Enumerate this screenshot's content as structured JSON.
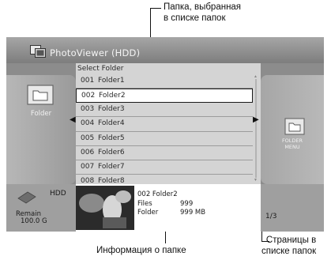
{
  "annotations": {
    "selected_folder_line1": "Папка, выбранная",
    "selected_folder_line2": "в списке папок",
    "folder_info": "Информация о папке",
    "pages_line1": "Страницы в",
    "pages_line2": "списке папок"
  },
  "app": {
    "title": "PhotoViewer (HDD)",
    "icon": "photo-viewer-icon"
  },
  "list": {
    "header": "Select Folder",
    "rows": [
      {
        "num": "001",
        "name": "Folder1"
      },
      {
        "num": "002",
        "name": "Folder2"
      },
      {
        "num": "003",
        "name": "Folder3"
      },
      {
        "num": "004",
        "name": "Folder4"
      },
      {
        "num": "005",
        "name": "Folder5"
      },
      {
        "num": "006",
        "name": "Folder6"
      },
      {
        "num": "007",
        "name": "Folder7"
      },
      {
        "num": "008",
        "name": "Folder8"
      }
    ],
    "selected_index": 1
  },
  "left_panel": {
    "label": "Folder",
    "icon": "folder-icon"
  },
  "right_panel": {
    "label_line1": "FOLDER",
    "label_line2": "MENU",
    "icon": "folder-menu-icon"
  },
  "storage": {
    "device": "HDD",
    "remain_label": "Remain",
    "remain_value": "100.0 G"
  },
  "info": {
    "title": "002  Folder2",
    "files_label": "Files",
    "files_value": "999",
    "folder_label": "Folder",
    "folder_value": "999 MB"
  },
  "paging": {
    "page": "1/3"
  },
  "colors": {
    "screen_bg": "#8c8c8c",
    "list_bg": "#d4d4d4",
    "selected_row": "#ffffff"
  }
}
